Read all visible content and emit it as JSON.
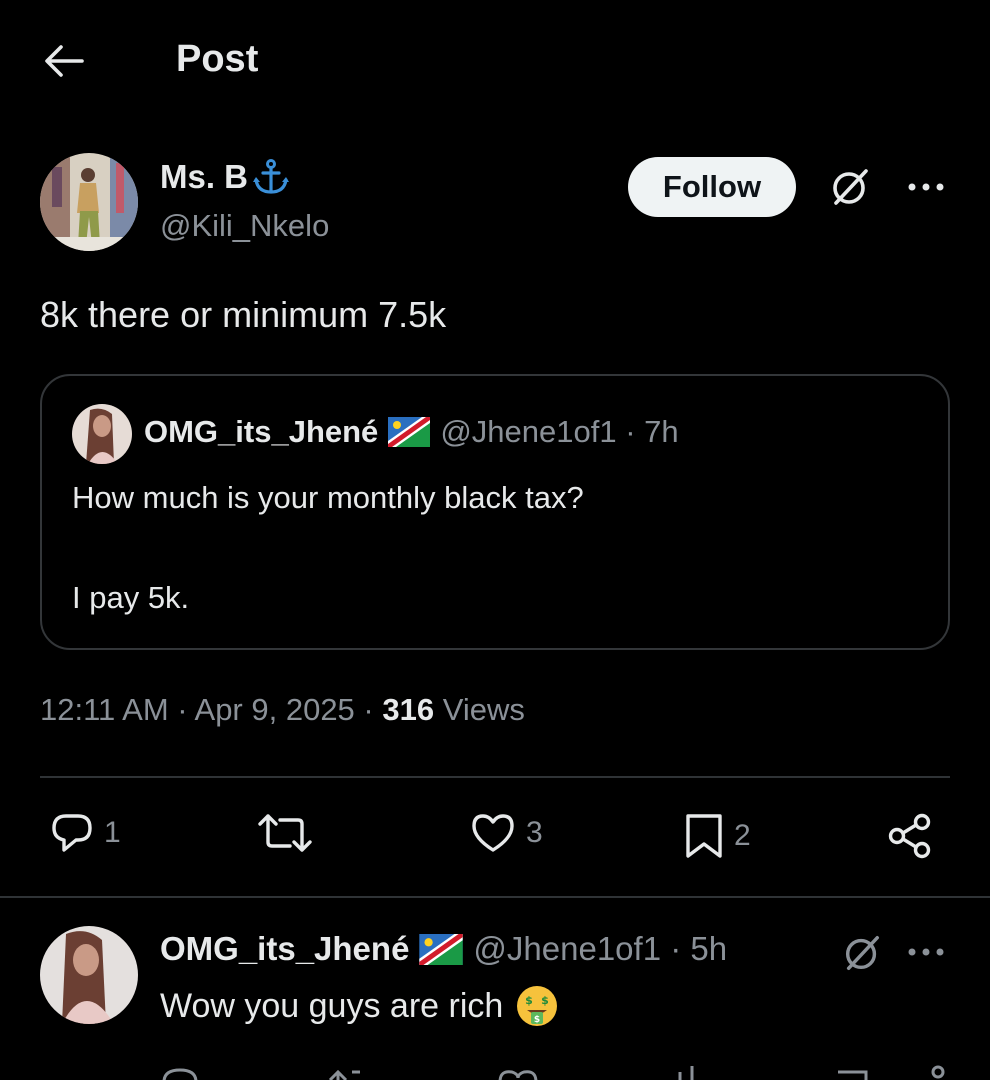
{
  "header": {
    "title": "Post",
    "back_icon": "arrow-left-icon"
  },
  "post": {
    "author": {
      "name": "Ms. B",
      "name_emoji": "anchor-icon",
      "handle": "@Kili_Nkelo"
    },
    "follow_label": "Follow",
    "text": "8k there or minimum 7.5k",
    "quote": {
      "name": "OMG_its_Jhené",
      "flag": "namibia-flag-icon",
      "handle_time": "@Jhene1of1 · 7h",
      "line1": "How much is your monthly black tax?",
      "line2": "I pay 5k."
    },
    "time_date": "12:11 AM · Apr 9, 2025 · ",
    "views_count": "316",
    "views_label": " Views",
    "actions": {
      "replies": "1",
      "likes": "3",
      "bookmarks": "2"
    }
  },
  "reply": {
    "name": "OMG_its_Jhené",
    "flag": "namibia-flag-icon",
    "handle_time": "@Jhene1of1 · 5h",
    "text": "Wow you guys are rich",
    "emoji": "money-mouth-face-icon"
  },
  "colors": {
    "background": "#000000",
    "text": "#e7e9ea",
    "secondary": "#8b9198",
    "border": "#2f3336",
    "follow_bg": "#eff3f4"
  }
}
